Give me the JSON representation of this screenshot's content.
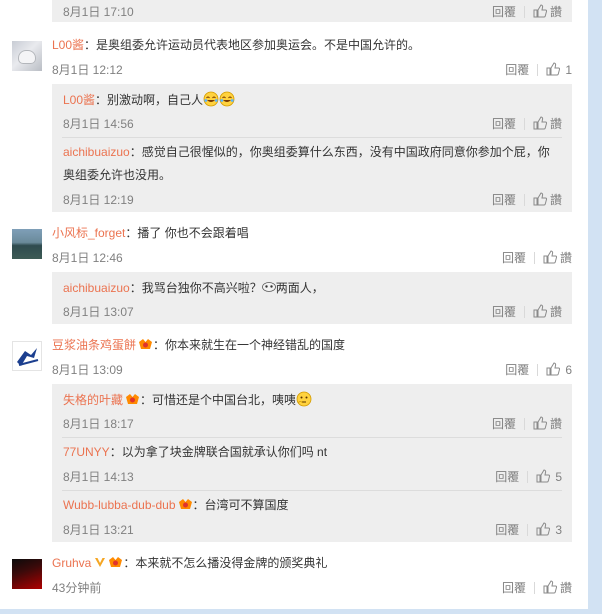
{
  "colors": {
    "username": "#eb7350",
    "muted": "#808080",
    "reply_bg": "#eeeeee",
    "page_frame": "#d2e2f3"
  },
  "top_partial": {
    "time": "8月1日 17:10",
    "reply": "回覆",
    "more": "讚"
  },
  "comments": [
    {
      "user": "L00酱",
      "text": "：是奥组委允许运动员代表地区参加奥运会。不是中国允许的。",
      "time": "8月1日 12:12",
      "reply": "回覆",
      "likes": "1",
      "replies": [
        {
          "user": "L00酱",
          "text": "：别激动啊，自己人",
          "time": "8月1日 14:56",
          "reply": "回覆",
          "likes": "讚"
        },
        {
          "user": "aichibuaizuo",
          "text": "：感觉自己很惺似的，你奥组委算什么东西，没有中国政府同意你参加个屁，你",
          "text2": "奥组委允许也没用。",
          "time": "8月1日 12:19",
          "reply": "回覆",
          "likes": "讚"
        }
      ]
    },
    {
      "user": "小风标_forget",
      "text": "：播了 你也不会跟着唱",
      "time": "8月1日 12:46",
      "reply": "回覆",
      "likes": "讚",
      "replies": [
        {
          "user": "aichibuaizuo",
          "text": "：我骂台独你不高兴啦？",
          "text2": "两面人，",
          "time": "8月1日 13:07",
          "reply": "回覆",
          "likes": "讚"
        }
      ]
    },
    {
      "user": "豆浆油条鸡蛋餅",
      "text": "：你本来就生在一个神经错乱的国度",
      "time": "8月1日 13:09",
      "reply": "回覆",
      "likes": "6",
      "replies": [
        {
          "user": "失格的叶藏",
          "text": "：可惜还是个中国台北，咦咦",
          "time": "8月1日 18:17",
          "reply": "回覆",
          "likes": "讚"
        },
        {
          "user": "77UNYY",
          "text": "：以为拿了块金牌联合国就承认你们吗 nt",
          "time": "8月1日 14:13",
          "reply": "回覆",
          "likes": "5"
        },
        {
          "user": "Wubb-lubba-dub-dub",
          "text": "：台湾可不算国度",
          "time": "8月1日 13:21",
          "reply": "回覆",
          "likes": "3"
        }
      ]
    },
    {
      "user": "Gruhva",
      "text": "：本来就不怎么播没得金牌的颁奖典礼",
      "time": "43分钟前",
      "reply": "回覆",
      "likes": "讚",
      "replies": []
    }
  ]
}
